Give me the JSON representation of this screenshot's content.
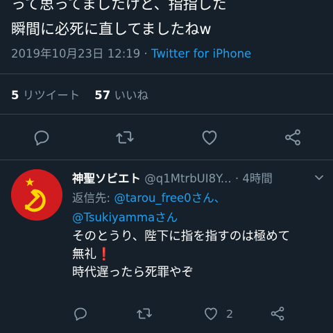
{
  "tweet": {
    "text_line1": "って思ってましたけど、指指した",
    "text_line2": "瞬間に必死に直してましたねw",
    "timestamp": "2019年10月23日 12:19",
    "separator": " · ",
    "source": "Twitter for iPhone",
    "retweets_count": "5",
    "retweets_label": "リツイート",
    "likes_count": "57",
    "likes_label": "いいね"
  },
  "reply": {
    "author_name": "神聖ソビエト",
    "author_handle": "@q1MtrbUI8Y...",
    "time": "· 4時間",
    "reply_prefix": "返信先:",
    "reply_to_1": "@tarou_free0さん、",
    "reply_to_2": "@Tsukiyammaさん",
    "text_line1": "そのとうり、陛下に指を指すのは極めて",
    "text_line2": "無礼",
    "excl": "❗",
    "text_line3": "時代遅ったら死罪やぞ",
    "like_count": "2"
  },
  "colors": {
    "background": "#15202b",
    "link": "#1da1f2",
    "muted": "#8899a6",
    "divider": "#38444d",
    "avatar_red": "#d01c1f",
    "emblem_gold": "#ffd600"
  },
  "icons": [
    "reply-icon",
    "retweet-icon",
    "like-icon",
    "share-icon",
    "chevron-down-icon"
  ]
}
